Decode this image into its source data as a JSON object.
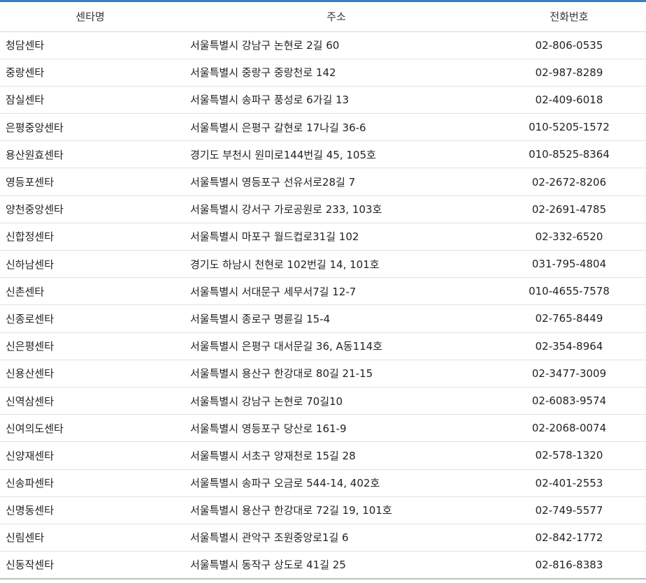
{
  "table": {
    "headers": [
      "센타명",
      "주소",
      "전화번호"
    ],
    "rows": [
      {
        "name": "청담센타",
        "address": "서울특별시 강남구 논현로 2길 60",
        "phone": "02-806-0535"
      },
      {
        "name": "중랑센타",
        "address": "서울특별시 중랑구 중랑천로 142",
        "phone": "02-987-8289"
      },
      {
        "name": "잠실센타",
        "address": "서울특별시 송파구 풍성로 6가길 13",
        "phone": "02-409-6018"
      },
      {
        "name": "은평중앙센타",
        "address": "서울특별시 은평구 갈현로 17나길 36-6",
        "phone": "010-5205-1572"
      },
      {
        "name": "용산원효센타",
        "address": "경기도 부천시 원미로144번길 45, 105호",
        "phone": "010-8525-8364"
      },
      {
        "name": "영등포센타",
        "address": "서울특별시 영등포구 선유서로28길 7",
        "phone": "02-2672-8206"
      },
      {
        "name": "양천중앙센타",
        "address": "서울특별시 강서구 가로공원로 233, 103호",
        "phone": "02-2691-4785"
      },
      {
        "name": "신합정센타",
        "address": "서울특별시 마포구 월드컵로31길 102",
        "phone": "02-332-6520"
      },
      {
        "name": "신하남센타",
        "address": "경기도 하남시 천현로 102번길 14, 101호",
        "phone": "031-795-4804"
      },
      {
        "name": "신촌센타",
        "address": "서울특별시 서대문구 세무서7길 12-7",
        "phone": "010-4655-7578"
      },
      {
        "name": "신종로센타",
        "address": "서울특별시 종로구 명륜길 15-4",
        "phone": "02-765-8449"
      },
      {
        "name": "신은평센타",
        "address": "서울특별시 은평구 대서문길 36, A동114호",
        "phone": "02-354-8964"
      },
      {
        "name": "신용산센타",
        "address": "서울특별시 용산구 한강대로 80길 21-15",
        "phone": "02-3477-3009"
      },
      {
        "name": "신역삼센타",
        "address": "서울특별시 강남구 논현로 70길10",
        "phone": "02-6083-9574"
      },
      {
        "name": "신여의도센타",
        "address": "서울특별시 영등포구 당산로 161-9",
        "phone": "02-2068-0074"
      },
      {
        "name": "신양재센타",
        "address": "서울특별시 서초구 양재천로 15길 28",
        "phone": "02-578-1320"
      },
      {
        "name": "신송파센타",
        "address": "서울특별시 송파구 오금로 544-14, 402호",
        "phone": "02-401-2553"
      },
      {
        "name": "신명동센타",
        "address": "서울특별시 용산구 한강대로 72길 19, 101호",
        "phone": "02-749-5577"
      },
      {
        "name": "신림센타",
        "address": "서울특별시 관악구 조원중앙로1길 6",
        "phone": "02-842-1772"
      },
      {
        "name": "신동작센타",
        "address": "서울특별시 동작구 상도로 41길 25",
        "phone": "02-816-8383"
      }
    ]
  },
  "colors": {
    "top_border": "#3a7fc4",
    "row_divider": "#e2e2e2",
    "text": "#222222"
  }
}
